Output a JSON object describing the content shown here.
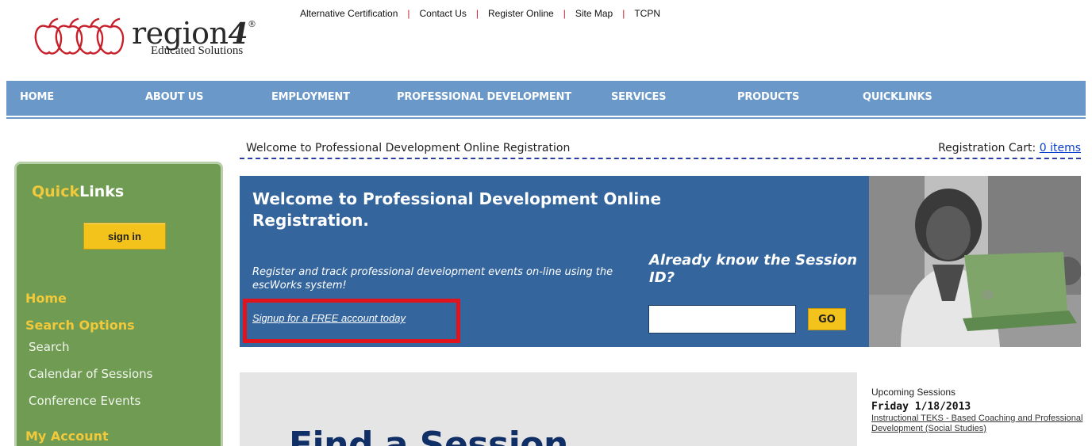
{
  "logo": {
    "wordmark": "region",
    "number": "4",
    "registered": "®",
    "tagline": "Educated Solutions"
  },
  "toplinks": [
    "Alternative Certification",
    "Contact Us",
    "Register Online",
    "Site Map",
    "TCPN"
  ],
  "toplink_separator": "|",
  "nav": [
    "HOME",
    "ABOUT US",
    "EMPLOYMENT",
    "PROFESSIONAL DEVELOPMENT",
    "SERVICES",
    "PRODUCTS",
    "QUICKLINKS"
  ],
  "sidebar": {
    "title_part1": "Quick",
    "title_part2": "Links",
    "signin_label": "sign in",
    "home": "Home",
    "search_options": "Search Options",
    "search": "Search",
    "calendar": "Calendar of Sessions",
    "conference": "Conference Events",
    "my_account": "My Account"
  },
  "header": {
    "welcome": "Welcome to Professional Development Online Registration",
    "cart_label": "Registration Cart:",
    "cart_items": "0 items"
  },
  "banner": {
    "title": "Welcome to Professional Development Online Registration.",
    "description": "Register and track professional development events on-line using the escWorks system!",
    "signup_link": "Signup for a FREE account today",
    "session_question": "Already know the Session ID?",
    "session_input_value": "",
    "go_label": "GO"
  },
  "find": {
    "title": "Find a Session"
  },
  "upcoming": {
    "heading": "Upcoming Sessions",
    "date": "Friday 1/18/2013",
    "session": "Instructional TEKS - Based Coaching and Professional Development (Social Studies)"
  },
  "colors": {
    "nav_blue": "#6a98c8",
    "banner_blue": "#35659d",
    "sidebar_green": "#6f9b52",
    "accent_yellow": "#f2c93a",
    "highlight_red": "#e0141c"
  }
}
